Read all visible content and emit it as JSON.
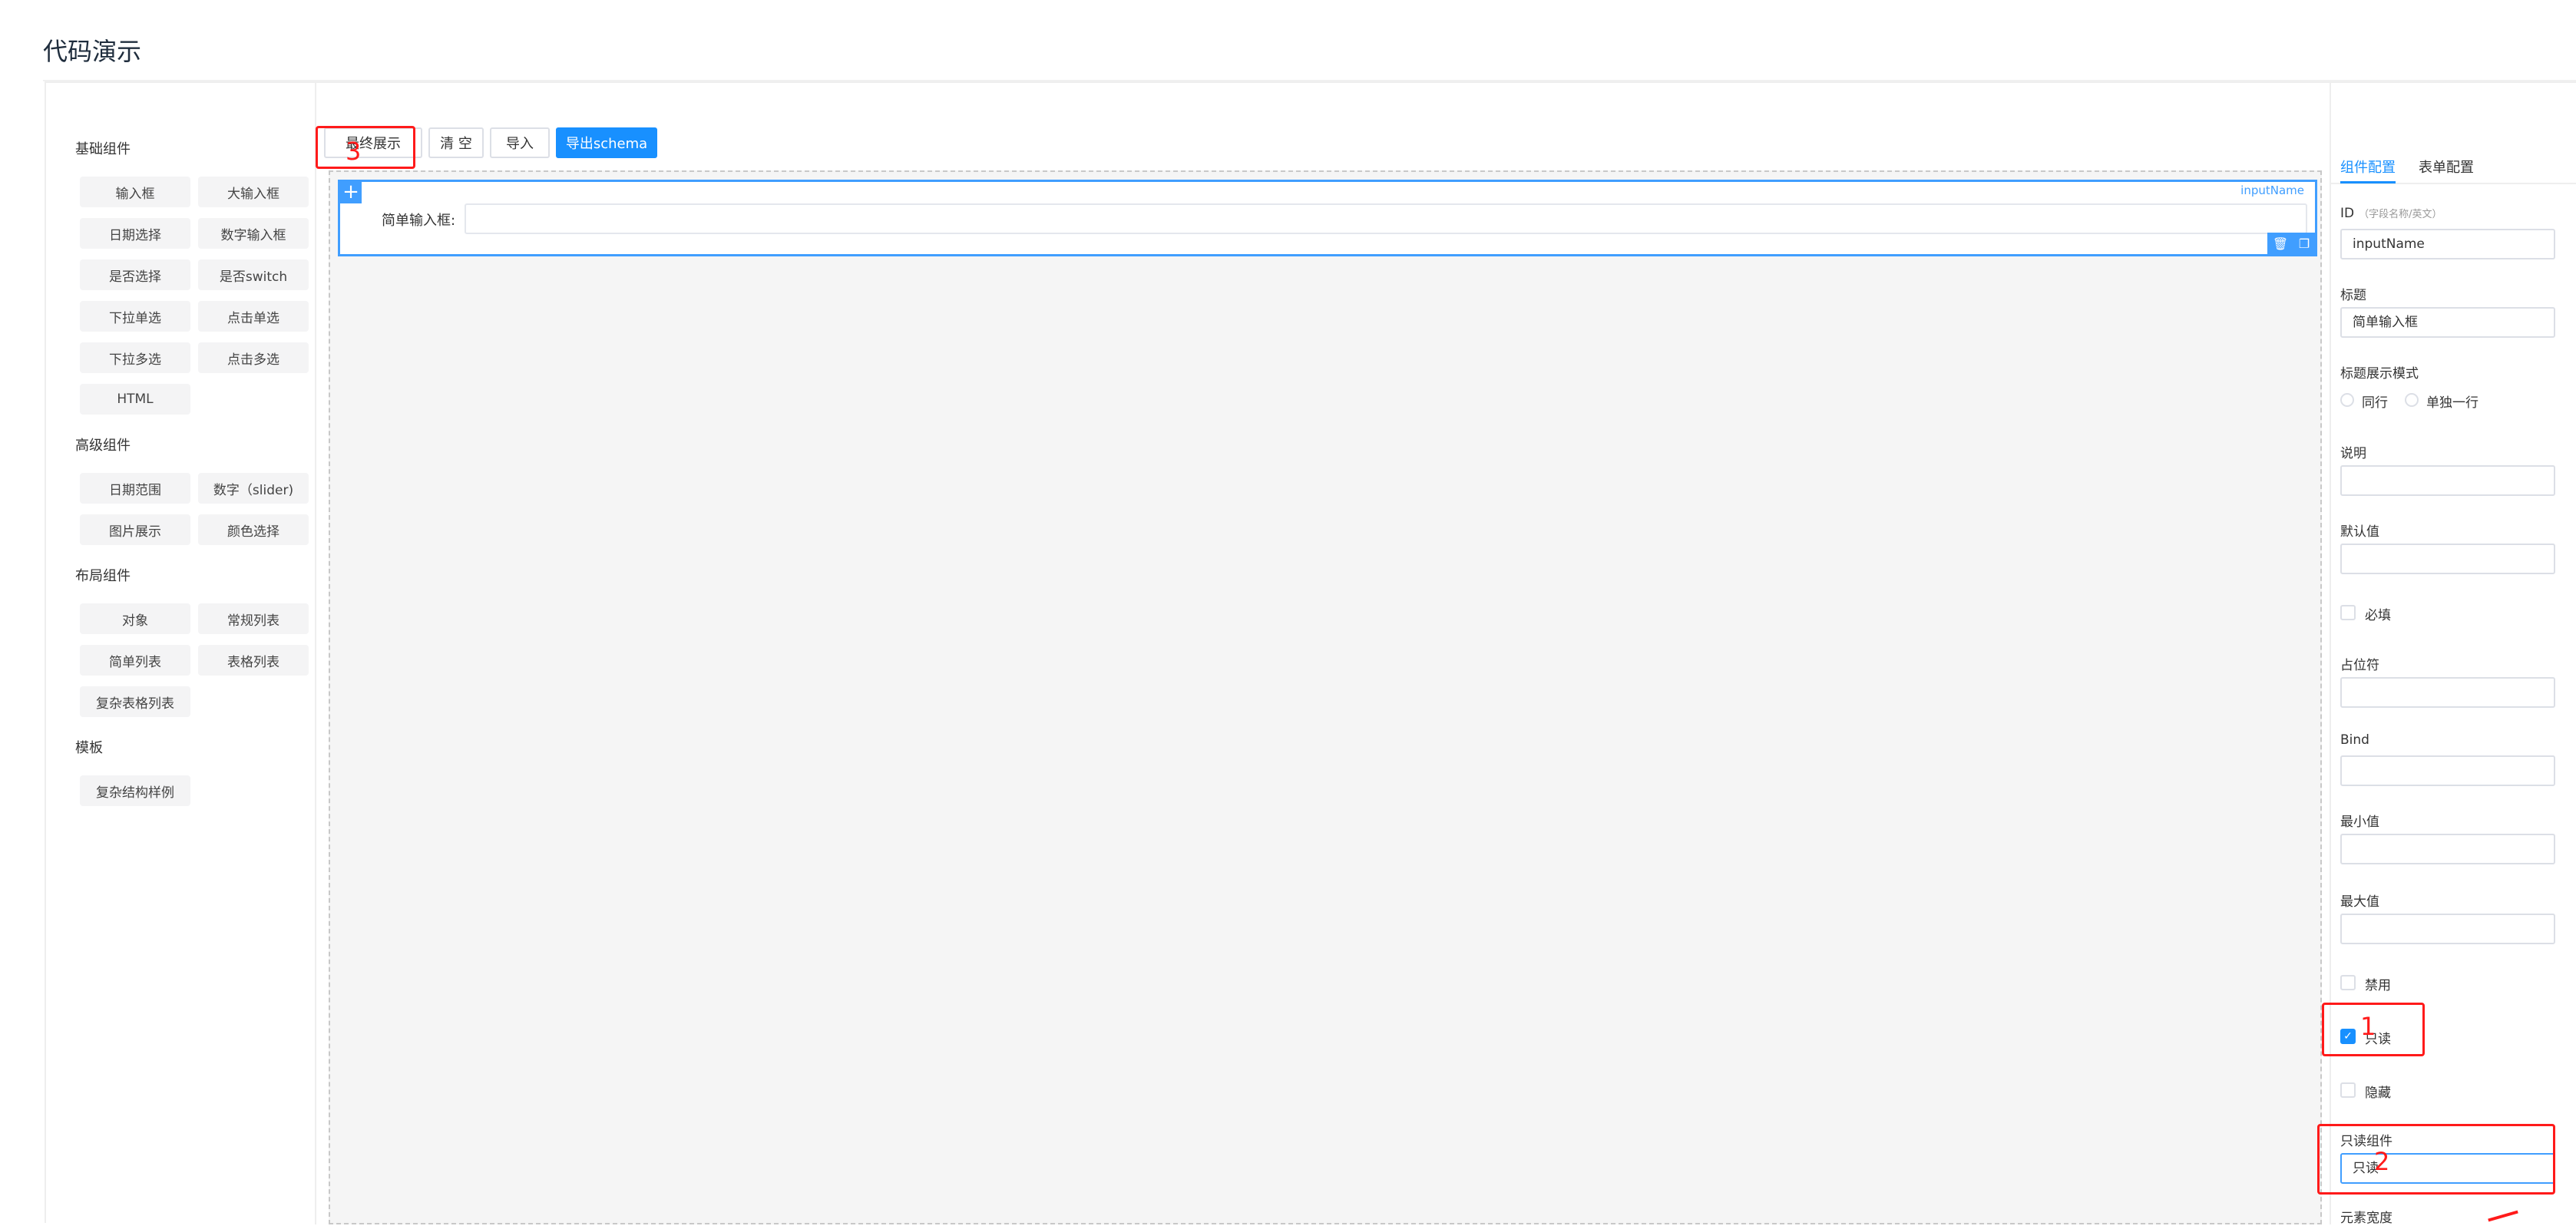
{
  "page": {
    "title": "代码演示"
  },
  "palette": {
    "basic": {
      "title": "基础组件",
      "items": [
        "输入框",
        "大输入框",
        "日期选择",
        "数字输入框",
        "是否选择",
        "是否switch",
        "下拉单选",
        "点击单选",
        "下拉多选",
        "点击多选",
        "HTML"
      ]
    },
    "advanced": {
      "title": "高级组件",
      "items": [
        "日期范围",
        "数字（slider)",
        "图片展示",
        "颜色选择"
      ]
    },
    "layout": {
      "title": "布局组件",
      "items": [
        "对象",
        "常规列表",
        "简单列表",
        "表格列表",
        "复杂表格列表"
      ]
    },
    "template": {
      "title": "模板",
      "items": [
        "复杂结构样例"
      ]
    }
  },
  "toolbar": {
    "preview": "最终展示",
    "clear": "清 空",
    "import": "导入",
    "export": "导出schema"
  },
  "canvas": {
    "field_label": "简单输入框:",
    "field_id": "inputName"
  },
  "config": {
    "tabs": [
      "组件配置",
      "表单配置"
    ],
    "id_label": "ID",
    "id_hint": "（字段名称/英文）",
    "id_value": "inputName",
    "title_label": "标题",
    "title_value": "简单输入框",
    "title_mode_label": "标题展示模式",
    "title_mode_options": [
      "同行",
      "单独一行"
    ],
    "desc_label": "说明",
    "default_label": "默认值",
    "required_label": "必填",
    "placeholder_label": "占位符",
    "bind_label": "Bind",
    "min_label": "最小值",
    "max_label": "最大值",
    "disabled_label": "禁用",
    "readonly_label": "只读",
    "hidden_label": "隐藏",
    "readonly_widget_label": "只读组件",
    "readonly_widget_value": "只读",
    "width_label": "元素宽度"
  },
  "annotations": {
    "one": "1",
    "two": "2",
    "three": "3"
  },
  "colors": {
    "accent": "#1890ff",
    "annotation": "#ff1a1a"
  }
}
